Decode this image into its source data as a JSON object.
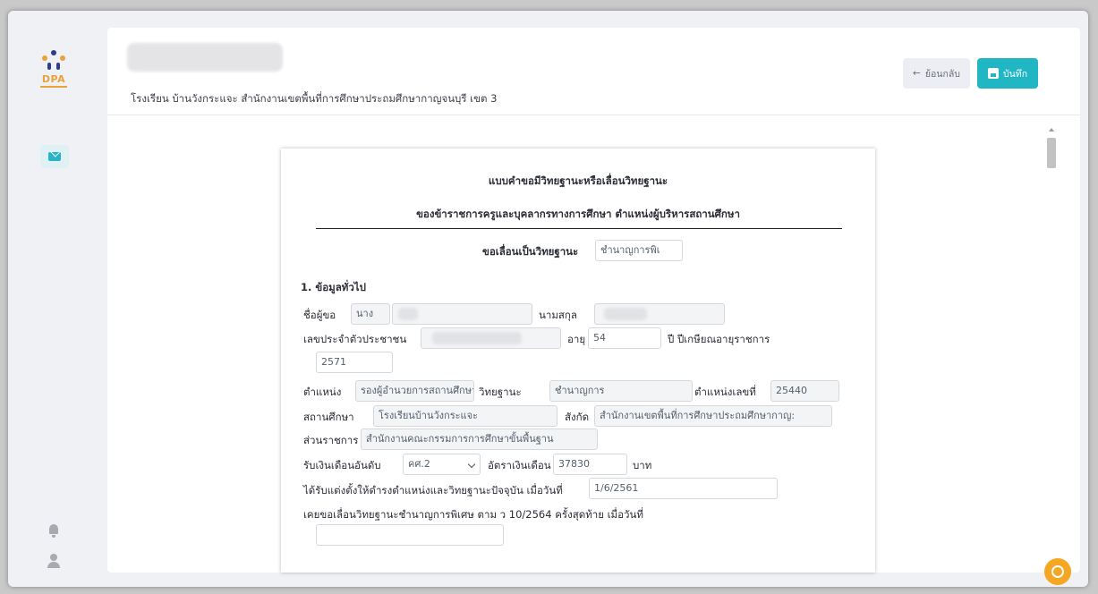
{
  "app": {
    "logo_text": "DPA",
    "colors": {
      "accent": "#21b6c4",
      "logo": "#e8a33a",
      "help": "#f5a623"
    }
  },
  "sidebar": {
    "icons": [
      "mail-icon",
      "bell-icon",
      "user-icon"
    ]
  },
  "header": {
    "school_line": "โรงเรียน บ้านวังกระแจะ สำนักงานเขตพื้นที่การศึกษาประถมศึกษากาญจนบุรี เขต 3",
    "back_label": "ย้อนกลับ",
    "save_label": "บันทึก"
  },
  "form": {
    "title": "แบบคำขอมีวิทยฐานะหรือเลื่อนวิทยฐานะ",
    "subtitle": "ของข้าราชการครูและบุคลากรทางการศึกษา ตำแหน่งผู้บริหารสถานศึกษา",
    "promote_label": "ขอเลื่อนเป็นวิทยฐานะ",
    "promote_value": "ชำนาญการพิเ",
    "section1": "1. ข้อมูลทั่วไป",
    "name_label": "ชื่อผู้ขอ",
    "title_value": "นาง",
    "surname_label": "นามสกุล",
    "id_label": "เลขประจำตัวประชาชน",
    "age_label": "อายุ",
    "age_value": "54",
    "retire_label": "ปี ปีเกษียณอายุราชการ",
    "retire_value": "2571",
    "position_label": "ตำแหน่ง",
    "position_value": "รองผู้อำนวยการสถานศึกษา",
    "academic_label": "วิทยฐานะ",
    "academic_value": "ชำนาญการ",
    "position_no_label": "ตำแหน่งเลขที่",
    "position_no_value": "25440",
    "school_label": "สถานศึกษา",
    "school_value": "โรงเรียนบ้านวังกระแจะ",
    "affiliation_label": "สังกัด",
    "affiliation_value": "สำนักงานเขตพื้นที่การศึกษาประถมศึกษากาญ:",
    "agency_label": "ส่วนราชการ",
    "agency_value": "สำนักงานคณะกรรมการการศึกษาขั้นพื้นฐาน",
    "salary_grade_label": "รับเงินเดือนอันดับ",
    "salary_grade_value": "คศ.2",
    "salary_rate_label": "อัตราเงินเดือน",
    "salary_rate_value": "37830",
    "baht_label": "บาท",
    "appointed_label": "ได้รับแต่งตั้งให้ดำรงตำแหน่งและวิทยฐานะปัจจุบัน เมื่อวันที่",
    "appointed_value": "1/6/2561",
    "previous_label": "เคยขอเลื่อนวิทยฐานะชำนาญการพิเศษ ตาม ว 10/2564 ครั้งสุดท้าย เมื่อวันที่",
    "previous_value": ""
  }
}
